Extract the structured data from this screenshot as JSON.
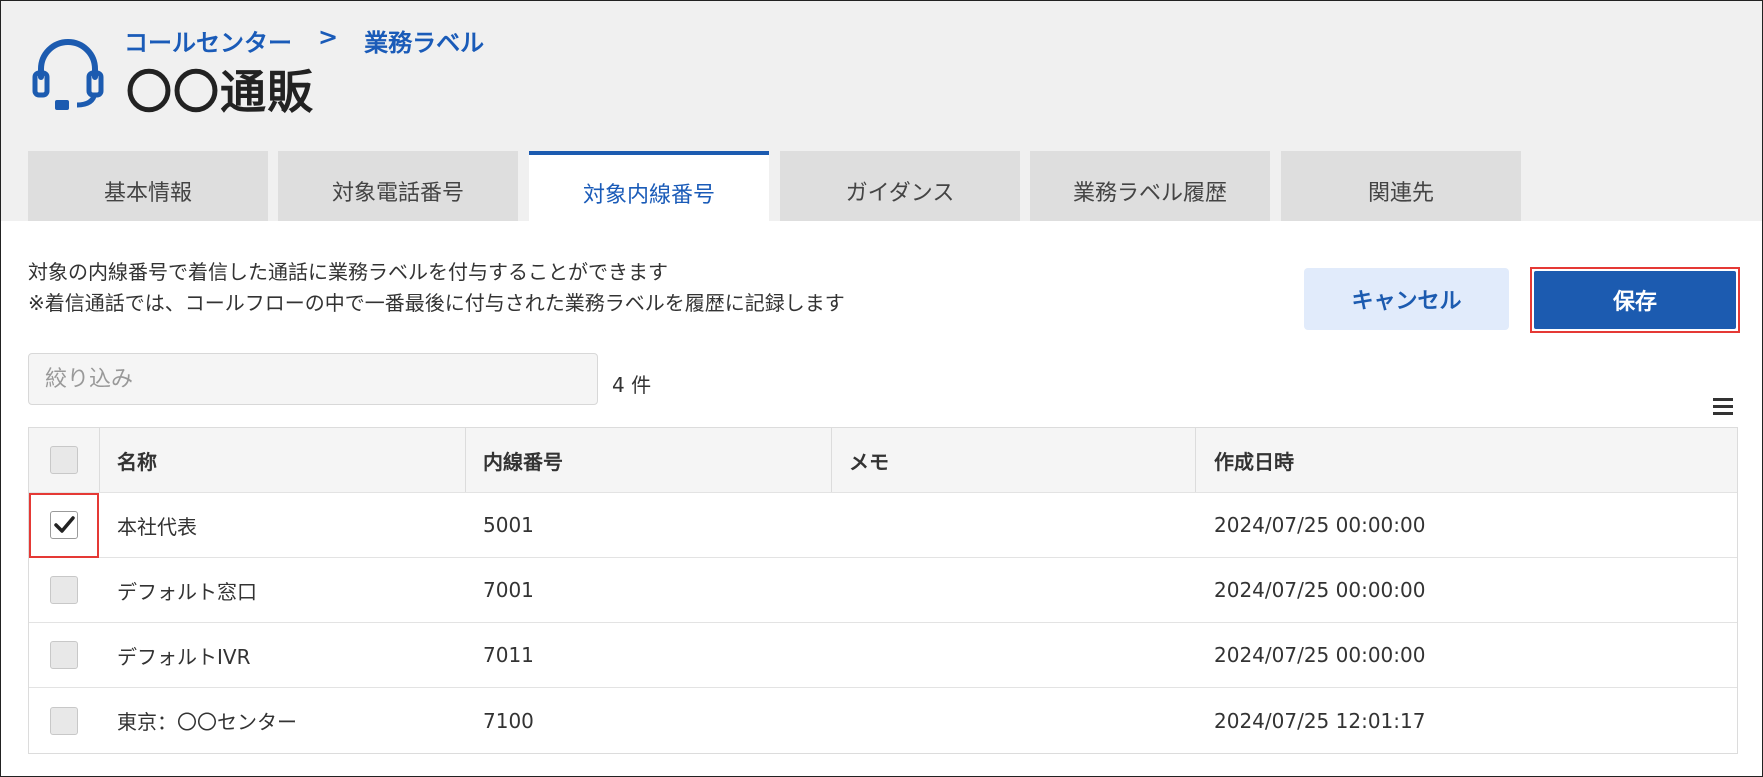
{
  "header": {
    "breadcrumb": [
      "コールセンター",
      "業務ラベル"
    ],
    "breadcrumb_separator": ">",
    "title": "〇〇通販",
    "icon": "headset-icon"
  },
  "tabs": [
    {
      "label": "基本情報",
      "active": false
    },
    {
      "label": "対象電話番号",
      "active": false
    },
    {
      "label": "対象内線番号",
      "active": true
    },
    {
      "label": "ガイダンス",
      "active": false
    },
    {
      "label": "業務ラベル履歴",
      "active": false
    },
    {
      "label": "関連先",
      "active": false
    }
  ],
  "description": {
    "line1": "対象の内線番号で着信した通話に業務ラベルを付与することができます",
    "line2": "※着信通話では、コールフローの中で一番最後に付与された業務ラベルを履歴に記録します"
  },
  "actions": {
    "cancel_label": "キャンセル",
    "save_label": "保存"
  },
  "filter": {
    "placeholder": "絞り込み",
    "value": ""
  },
  "count_label": "4 件",
  "table": {
    "columns": [
      "名称",
      "内線番号",
      "メモ",
      "作成日時"
    ],
    "rows": [
      {
        "name": "本社代表",
        "extension": "5001",
        "memo": "",
        "created": "2024/07/25 00:00:00",
        "checked": true
      },
      {
        "name": "デフォルト窓口",
        "extension": "7001",
        "memo": "",
        "created": "2024/07/25 00:00:00",
        "checked": false
      },
      {
        "name": "デフォルトIVR",
        "extension": "7011",
        "memo": "",
        "created": "2024/07/25 00:00:00",
        "checked": false
      },
      {
        "name": "東京：〇〇センター",
        "extension": "7100",
        "memo": "",
        "created": "2024/07/25 12:01:17",
        "checked": false
      }
    ]
  },
  "colors": {
    "accent": "#1c5bb0",
    "highlight": "#e53935",
    "cancel_bg": "#e1ebfb",
    "header_bg": "#f0f0f0"
  }
}
